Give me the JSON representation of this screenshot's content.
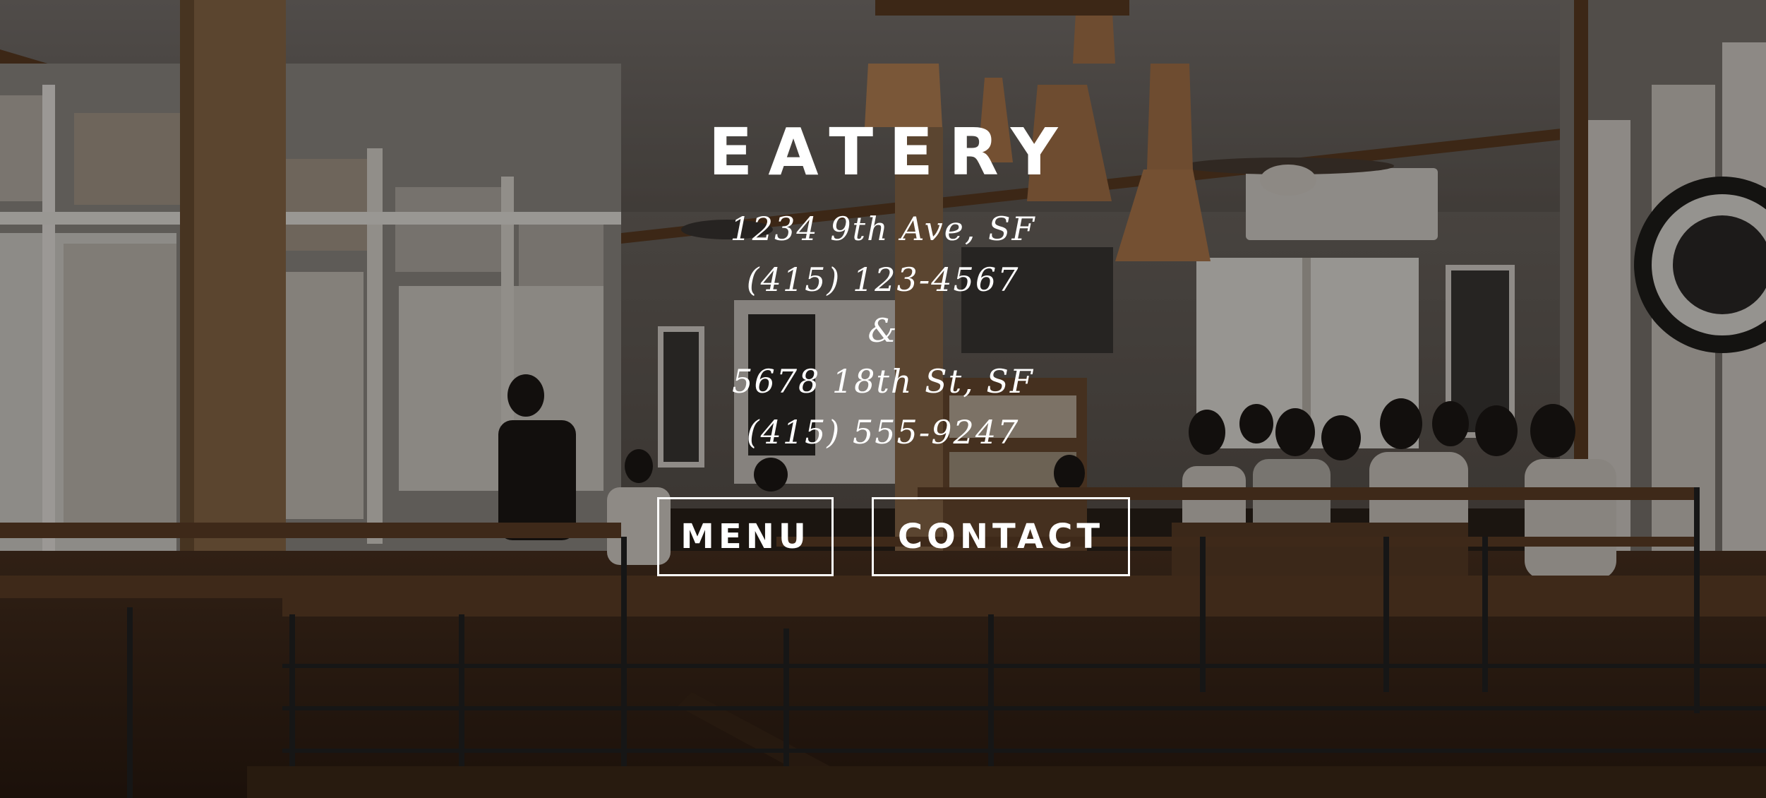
{
  "hero": {
    "brand": "EATERY",
    "locations": [
      {
        "address": "1234 9th Ave, SF",
        "phone": "(415) 123-4567"
      },
      {
        "address": "5678 18th St, SF",
        "phone": "(415) 555-9247"
      }
    ],
    "separator": "&"
  },
  "buttons": {
    "menu_label": "MENU",
    "contact_label": "CONTACT"
  },
  "colors": {
    "text": "#ffffff",
    "overlay": "#000000",
    "wood": "#6b4a2e"
  }
}
